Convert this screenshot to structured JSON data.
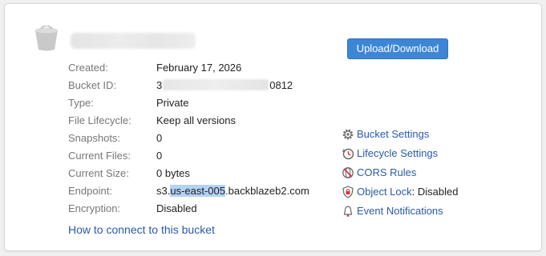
{
  "buttons": {
    "upload_download": "Upload/Download"
  },
  "details": {
    "created": {
      "label": "Created:",
      "value": "February 17, 2026"
    },
    "bucket_id": {
      "label": "Bucket ID:",
      "prefix": "3",
      "suffix": "0812"
    },
    "type": {
      "label": "Type:",
      "value": "Private"
    },
    "file_lifecycle": {
      "label": "File Lifecycle:",
      "value": "Keep all versions"
    },
    "snapshots": {
      "label": "Snapshots:",
      "value": "0"
    },
    "current_files": {
      "label": "Current Files:",
      "value": "0"
    },
    "current_size": {
      "label": "Current Size:",
      "value": "0 bytes"
    },
    "endpoint": {
      "label": "Endpoint:",
      "prefix": "s3.",
      "selected": "us-east-005",
      "suffix": ".backblazeb2.com"
    },
    "encryption": {
      "label": "Encryption:",
      "value": "Disabled"
    }
  },
  "links": {
    "connect": "How to connect to this bucket"
  },
  "actions": {
    "bucket_settings": "Bucket Settings",
    "lifecycle_settings": "Lifecycle Settings",
    "cors_rules": "CORS Rules",
    "object_lock": "Object Lock",
    "object_lock_status": "Disabled",
    "event_notifications": "Event Notifications"
  },
  "colors": {
    "link": "#2a5aaa",
    "button": "#3d86d6",
    "label": "#777777",
    "value": "#222222",
    "selection": "#b3d3f5",
    "icon_red": "#d9343a"
  }
}
